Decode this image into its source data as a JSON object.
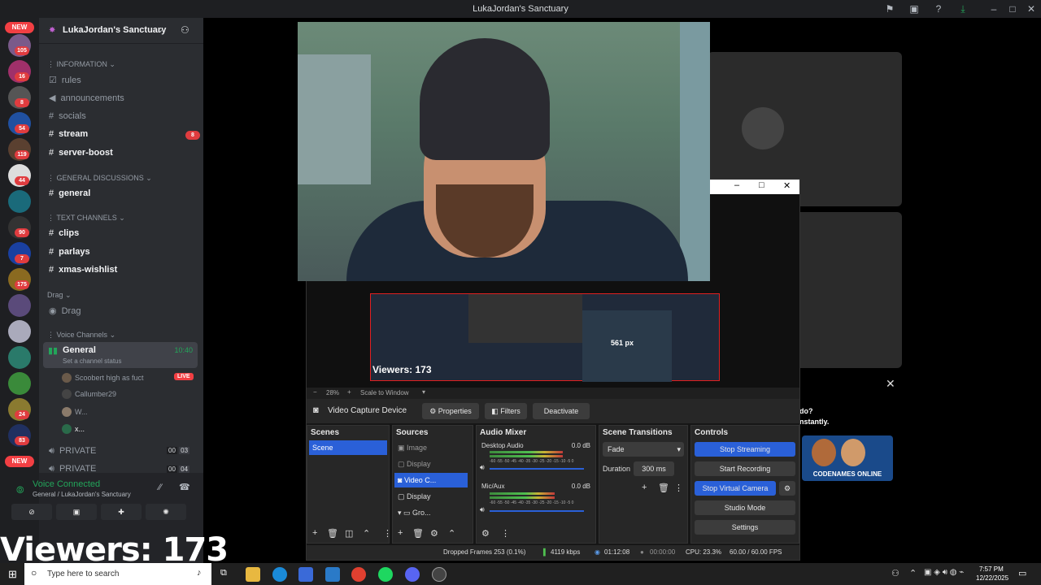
{
  "window": {
    "title": "LukaJordan's Sanctuary"
  },
  "servers": {
    "new_top": "NEW",
    "new_bottom": "NEW",
    "badges": [
      "105",
      "16",
      "8",
      "54",
      "119",
      "44",
      "",
      "90",
      "7",
      "175",
      "",
      "",
      "",
      "",
      "24",
      "83"
    ]
  },
  "server_header": {
    "name": "LukaJordan's Sanctuary"
  },
  "channels": {
    "cat_information": "INFORMATION",
    "rules": "rules",
    "announcements": "announcements",
    "socials": "socials",
    "stream": "stream",
    "stream_badge": "8",
    "server_boost": "server-boost",
    "cat_general": "GENERAL DISCUSSIONS",
    "general": "general",
    "cat_text": "TEXT CHANNELS",
    "clips": "clips",
    "parlays": "parlays",
    "xmas": "xmas-wishlist",
    "cat_drag": "Drag",
    "drag": "Drag",
    "cat_voice": "Voice Channels",
    "voice_general": "General",
    "voice_general_time": "10:40",
    "voice_status": "Set a channel status",
    "members": [
      {
        "name": "Scoobert high as fuct",
        "live": "LIVE"
      },
      {
        "name": "Callumber29"
      },
      {
        "name": "W..."
      },
      {
        "name": "x..."
      }
    ],
    "private1": "PRIVATE",
    "private1_a": "00",
    "private1_b": "03",
    "private2": "PRIVATE",
    "private2_a": "00",
    "private2_b": "04"
  },
  "voice_panel": {
    "status": "Voice Connected",
    "location": "General / LukaJordan's Sanctuary"
  },
  "overlay": {
    "viewers": "Viewers: 173",
    "inner_viewers": "Viewers: 173",
    "measure": "561 px"
  },
  "side_panel": {
    "text1": "do?",
    "text2": "nstantly.",
    "game": "CODENAMES ONLINE"
  },
  "obs": {
    "zoom": "28%",
    "scale": "Scale to Window",
    "source_name": "Video Capture Device",
    "properties": "Properties",
    "filters": "Filters",
    "deactivate": "Deactivate",
    "scenes_title": "Scenes",
    "scene_item": "Scene",
    "sources_title": "Sources",
    "sources": [
      "Image",
      "Display",
      "Video C...",
      "Display",
      "Gro..."
    ],
    "mixer_title": "Audio Mixer",
    "desktop_audio": "Desktop Audio",
    "desktop_db": "0.0 dB",
    "mic_aux": "Mic/Aux",
    "mic_db": "0.0 dB",
    "scale_labels": "-60 -55 -50 -45 -40 -35 -30 -25 -20 -15 -10 -5 0",
    "transitions_title": "Scene Transitions",
    "transition": "Fade",
    "duration_label": "Duration",
    "duration": "300 ms",
    "controls_title": "Controls",
    "stop_streaming": "Stop Streaming",
    "start_recording": "Start Recording",
    "stop_virtual": "Stop Virtual Camera",
    "studio_mode": "Studio Mode",
    "settings": "Settings",
    "dropped": "Dropped Frames 253 (0.1%)",
    "kbps": "4119 kbps",
    "live_time": "01:12:08",
    "rec_time": "00:00:00",
    "cpu": "CPU: 23.3%",
    "fps": "60.00 / 60.00 FPS"
  },
  "taskbar": {
    "search": "Type here to search",
    "time": "7:57 PM",
    "date": "12/22/2025"
  }
}
